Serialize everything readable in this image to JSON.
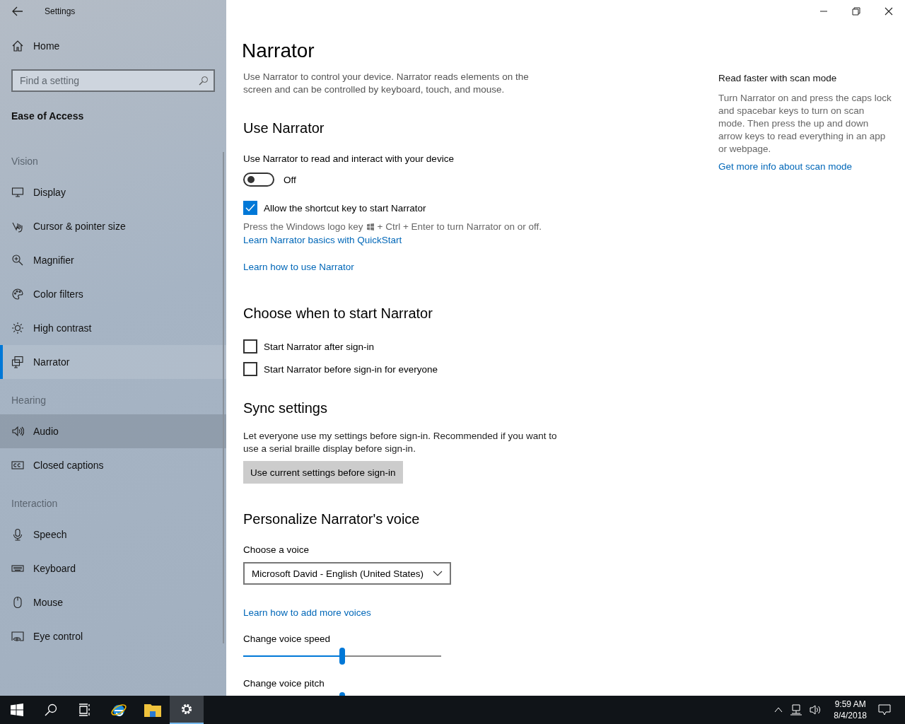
{
  "window": {
    "title": "Settings"
  },
  "sidebar": {
    "home": "Home",
    "search": {
      "placeholder": "Find a setting"
    },
    "section": "Ease of Access",
    "groups": [
      {
        "heading": "Vision",
        "items": [
          {
            "label": "Display",
            "kind": "display",
            "selected": false,
            "hovered": false
          },
          {
            "label": "Cursor & pointer size",
            "kind": "cursor",
            "selected": false,
            "hovered": false
          },
          {
            "label": "Magnifier",
            "kind": "magnifier",
            "selected": false,
            "hovered": false
          },
          {
            "label": "Color filters",
            "kind": "palette",
            "selected": false,
            "hovered": false
          },
          {
            "label": "High contrast",
            "kind": "sun",
            "selected": false,
            "hovered": false
          },
          {
            "label": "Narrator",
            "kind": "narrator",
            "selected": true,
            "hovered": false
          }
        ]
      },
      {
        "heading": "Hearing",
        "items": [
          {
            "label": "Audio",
            "kind": "audio",
            "selected": false,
            "hovered": true
          },
          {
            "label": "Closed captions",
            "kind": "cc",
            "selected": false,
            "hovered": false
          }
        ]
      },
      {
        "heading": "Interaction",
        "items": [
          {
            "label": "Speech",
            "kind": "mic",
            "selected": false,
            "hovered": false
          },
          {
            "label": "Keyboard",
            "kind": "keyboard",
            "selected": false,
            "hovered": false
          },
          {
            "label": "Mouse",
            "kind": "mouse",
            "selected": false,
            "hovered": false
          },
          {
            "label": "Eye control",
            "kind": "eye",
            "selected": false,
            "hovered": false
          }
        ]
      }
    ]
  },
  "page": {
    "title": "Narrator",
    "intro": "Use Narrator to control your device. Narrator reads elements on the screen and can be controlled by keyboard, touch, and mouse.",
    "use_narrator": {
      "heading": "Use Narrator",
      "toggle_label": "Use Narrator to read and interact with your device",
      "toggle": {
        "on": false,
        "state_text": "Off"
      },
      "shortcut": {
        "label": "Allow the shortcut key to start Narrator",
        "checked": true
      },
      "hint_before": "Press the Windows logo key",
      "hint_after": "+ Ctrl + Enter to turn Narrator on or off.",
      "quickstart_link": "Learn Narrator basics with QuickStart",
      "learn_link": "Learn how to use Narrator"
    },
    "start": {
      "heading": "Choose when to start Narrator",
      "options": [
        {
          "label": "Start Narrator after sign-in",
          "checked": false
        },
        {
          "label": "Start Narrator before sign-in for everyone",
          "checked": false
        }
      ]
    },
    "sync": {
      "heading": "Sync settings",
      "text": "Let everyone use my settings before sign-in. Recommended if you want to use a serial braille display before sign-in.",
      "button": "Use current settings before sign-in"
    },
    "voice": {
      "heading": "Personalize Narrator's voice",
      "voice_label": "Choose a voice",
      "voice_value": "Microsoft David - English (United States)",
      "more_link": "Learn how to add more voices",
      "sliders": [
        {
          "label": "Change voice speed",
          "level": 0.5
        },
        {
          "label": "Change voice pitch",
          "level": 0.5
        }
      ]
    }
  },
  "aside": {
    "heading": "Read faster with scan mode",
    "text": "Turn Narrator on and press the caps lock and spacebar keys to turn on scan mode. Then press the up and down arrow keys to read everything in an app or webpage.",
    "link": "Get more info about scan mode"
  },
  "taskbar": {
    "apps": [
      {
        "kind": "start",
        "active": false
      },
      {
        "kind": "search",
        "active": false
      },
      {
        "kind": "taskview",
        "active": false
      },
      {
        "kind": "browser",
        "active": false
      },
      {
        "kind": "folder",
        "active": false
      },
      {
        "kind": "settings",
        "active": true
      }
    ],
    "time": "9:59 AM",
    "date": "8/4/2018"
  }
}
